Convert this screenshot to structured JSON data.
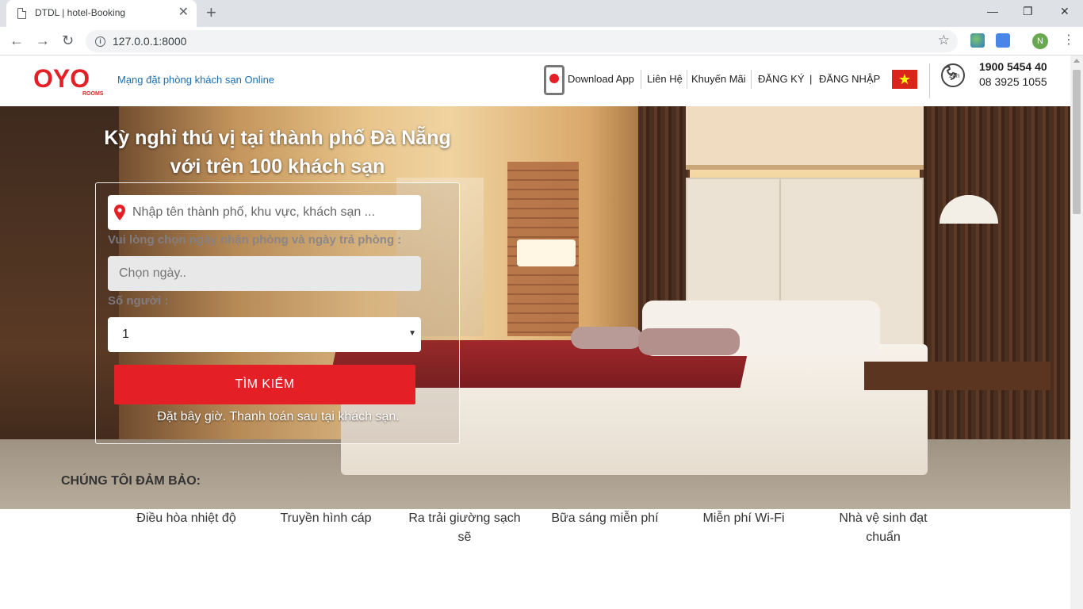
{
  "browser": {
    "tab_title": "DTDL | hotel-Booking",
    "tab_close": "✕",
    "new_tab": "+",
    "url": "127.0.0.1:8000",
    "profile_initial": "N",
    "window_controls": [
      "—",
      "❐",
      "✕"
    ]
  },
  "header": {
    "logo_text": "OYO",
    "logo_sub": "ROOMS",
    "tagline": "Mạng đặt phòng khách sạn Online",
    "nav": {
      "download_app": "Download App",
      "contact": "Liên Hệ",
      "promotions": "Khuyến Mãi",
      "register": "ĐĂNG KÝ",
      "divider": "|",
      "login": "ĐĂNG NHẬP"
    },
    "hotline_icon_label": "24h",
    "hotline_primary": "1900 5454 40",
    "hotline_secondary": "08 3925 1055"
  },
  "hero": {
    "title_line1": "Kỳ nghỉ thú vị tại thành phố Đà Nẵng",
    "title_line2": "với trên 100 khách sạn",
    "search": {
      "location_placeholder": "Nhập tên thành phố, khu vực, khách sạn ...",
      "date_label": "Vui lòng chọn ngày nhận phòng và ngày trả phòng :",
      "date_placeholder": "Chọn ngày..",
      "guests_label": "Số người :",
      "guests_value": "1",
      "submit_label": "TÌM KIẾM",
      "note": "Đặt bây giờ. Thanh toán sau tại khách sạn."
    }
  },
  "guarantees": {
    "title": "CHÚNG TÔI ĐẢM BẢO:",
    "items": [
      "Điều hòa nhiệt độ",
      "Truyền hình cáp",
      "Ra trải giường sạch sẽ",
      "Bữa sáng miễn phí",
      "Miễn phí Wi-Fi",
      "Nhà vệ sinh đạt chuẩn"
    ]
  },
  "colors": {
    "brand_red": "#e41f26",
    "link_blue": "#1a6fb3"
  }
}
